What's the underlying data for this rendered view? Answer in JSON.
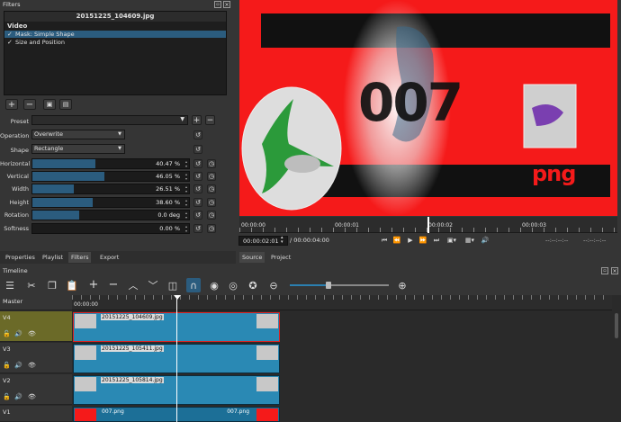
{
  "filters_panel": {
    "title": "Filters",
    "clip_name": "20151225_104609.jpg",
    "section": "Video",
    "items": [
      {
        "check": "✓",
        "label": "Mask: Simple Shape"
      },
      {
        "check": "✓",
        "label": "Size and Position"
      }
    ],
    "preset_label": "Preset",
    "preset_value": "",
    "operation_label": "Operation",
    "operation_value": "Overwrite",
    "shape_label": "Shape",
    "shape_value": "Rectangle",
    "params": [
      {
        "label": "Horizontal",
        "value": "40.47 %",
        "fraction": 0.4047
      },
      {
        "label": "Vertical",
        "value": "46.05 %",
        "fraction": 0.4605
      },
      {
        "label": "Width",
        "value": "26.51 %",
        "fraction": 0.2651
      },
      {
        "label": "Height",
        "value": "38.60 %",
        "fraction": 0.386
      },
      {
        "label": "Rotation",
        "value": "0.0 deg",
        "fraction": 0.3
      },
      {
        "label": "Softness",
        "value": "0.00 %",
        "fraction": 0.0
      }
    ]
  },
  "left_tabs": [
    "Properties",
    "Playlist",
    "Filters",
    "Export"
  ],
  "player": {
    "ruler": [
      "00:00:00",
      "00:00:01",
      "00:00:02",
      "00:00:03"
    ],
    "timecode": "00:00:02:01",
    "duration": "/ 00:00:04:00",
    "in_point": "--:--:--:--",
    "out_point": "--:--:--:--",
    "tabs": [
      "Source",
      "Project"
    ],
    "overlay_digits": "007",
    "overlay_png": "png",
    "fraction_playhead": 0.49
  },
  "timeline": {
    "title": "Timeline",
    "master_label": "Master",
    "ruler_start": "00:00:00",
    "tracks": [
      {
        "name": "V4",
        "clip": "20151225_104609.jpg"
      },
      {
        "name": "V3",
        "clip": "20151225_105411.jpg"
      },
      {
        "name": "V2",
        "clip": "20151225_105814.jpg"
      },
      {
        "name": "V1",
        "clip": "007.png",
        "clip_end": "007.png"
      }
    ]
  },
  "colors": {
    "accent": "#2b5c7e",
    "clip": "#2a89b4",
    "selected_track": "#6b6a28",
    "preview_red": "#f51a1a"
  }
}
